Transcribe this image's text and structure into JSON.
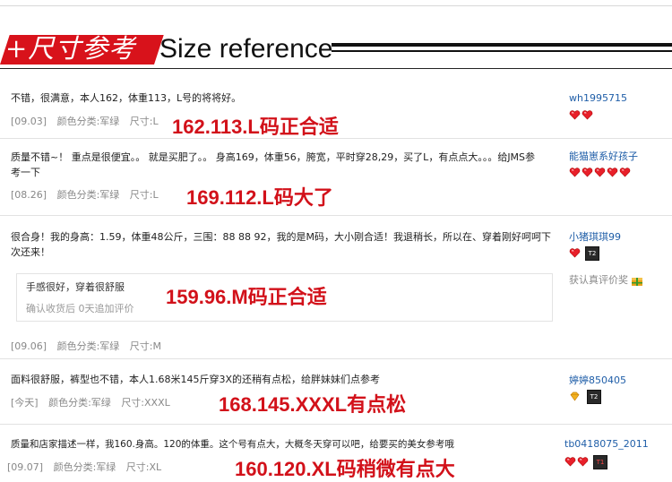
{
  "header": {
    "cn_title": "+尺寸参考",
    "en_title": "Size reference"
  },
  "reviews": [
    {
      "text": "不错，很满意，本人162，体重113，L号的将将好。",
      "date": "[09.03]",
      "color": "颜色分类:军绿",
      "size": "尺寸:L",
      "highlight": "162.113.L码正合适",
      "user": "wh1995715",
      "hearts": 2,
      "badge": ""
    },
    {
      "text": "质量不错~！ 重点是很便宜。。 就是买肥了。。 身高169，体重56，胯宽，平时穿28,29，买了L，有点点大。。。给JMS参考一下",
      "date": "[08.26]",
      "color": "颜色分类:军绿",
      "size": "尺寸:L",
      "highlight": "169.112.L码大了",
      "user": "能猫崽系好孩子",
      "hearts": 5,
      "badge": ""
    },
    {
      "text": "很合身！我的身高：1.59，体重48公斤，三围：88 88 92，我的是M码，大小刚合适！我退稍长，所以在、穿着刚好呵呵下次还来！",
      "date": "[09.06]",
      "color": "颜色分类:军绿",
      "size": "尺寸:M",
      "highlight": "159.96.M码正合适",
      "user": "小猪琪琪99",
      "hearts": 1,
      "badge": "T2",
      "reply_text": "手感很好，穿着很舒服",
      "reply_meta": "确认收货后  0天追加评价",
      "reward": "获认真评价奖"
    },
    {
      "text": "面料很舒服，裤型也不错，本人1.68米145斤穿3X的还稍有点松，给胖妹妹们点参考",
      "date": "[今天]",
      "color": "颜色分类:军绿",
      "size": "尺寸:XXXL",
      "highlight": "168.145.XXXL有点松",
      "user": "婷婷850405",
      "hearts": 0,
      "badge": "T2"
    },
    {
      "text": "质量和店家描述一样，我160.身高。120的体重。这个号有点大，大概冬天穿可以吧，给要买的美女参考哦",
      "date": "[09.07]",
      "color": "颜色分类:军绿",
      "size": "尺寸:XL",
      "highlight": "160.120.XL码稍微有点大",
      "user": "tb0418075_2011",
      "hearts": 2,
      "badge": "T1"
    }
  ],
  "colors": {
    "accent": "#d2111a",
    "link": "#1f5ea8",
    "muted": "#888888"
  }
}
